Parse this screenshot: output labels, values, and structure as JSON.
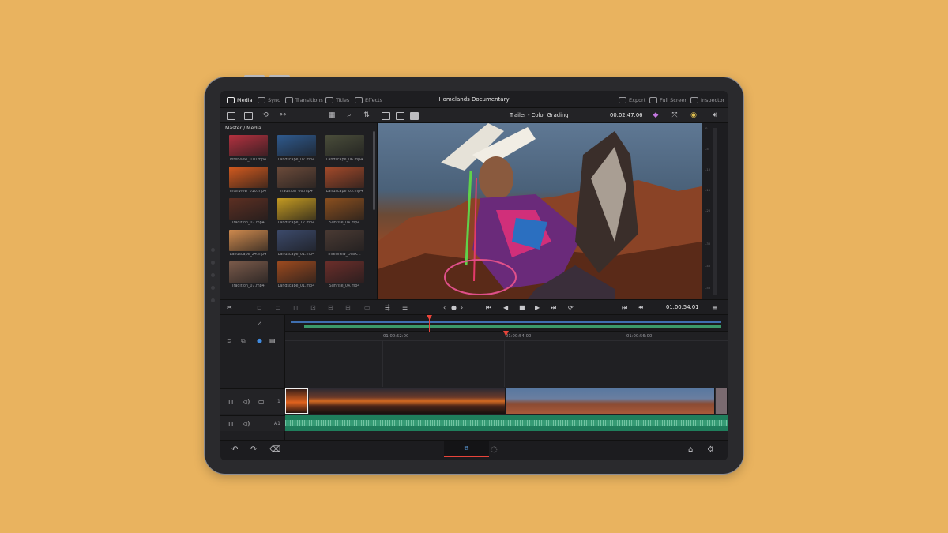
{
  "app": {
    "title": "Homelands Documentary"
  },
  "topbar": {
    "tabs": [
      {
        "label": "Media",
        "icon": "media-icon",
        "active": true
      },
      {
        "label": "Sync",
        "icon": "sync-icon"
      },
      {
        "label": "Transitions",
        "icon": "transitions-icon"
      },
      {
        "label": "Titles",
        "icon": "titles-icon"
      },
      {
        "label": "Effects",
        "icon": "effects-icon"
      }
    ],
    "right": [
      {
        "label": "Export",
        "icon": "export-icon"
      },
      {
        "label": "Full Screen",
        "icon": "full-screen-icon"
      },
      {
        "label": "Inspector",
        "icon": "inspector-icon"
      }
    ]
  },
  "toolbar": {
    "preview_name": "Trailer - Color Grading",
    "timecode": "00:02:47:06"
  },
  "media": {
    "path": "Master / Media",
    "clips": [
      {
        "label": "Interview_010.mp4",
        "color": "#b3313f"
      },
      {
        "label": "Landscape_02.mp4",
        "color": "#2f5a8e"
      },
      {
        "label": "Landscape_06.mp4",
        "color": "#4a4d3a"
      },
      {
        "label": "Interview_010.mp4",
        "color": "#d35a1e"
      },
      {
        "label": "Tradition_06.mp4",
        "color": "#6c4b3a"
      },
      {
        "label": "Landscape_03.mp4",
        "color": "#a44a2a"
      },
      {
        "label": "Tradition_07.mp4",
        "color": "#5c2f22"
      },
      {
        "label": "Landscape_12.mp4",
        "color": "#c49a22"
      },
      {
        "label": "Sunrise_04.mp4",
        "color": "#8a4f1f"
      },
      {
        "label": "Landscape_24.mp4",
        "color": "#cf8a4e"
      },
      {
        "label": "Landscape_01.mp4",
        "color": "#3c4a6b"
      },
      {
        "label": "Interview_Dusk...",
        "color": "#4a3a33"
      },
      {
        "label": "Tradition_07.mp4",
        "color": "#7a5a4a"
      },
      {
        "label": "Landscape_01.mp4",
        "color": "#9c4a1f"
      },
      {
        "label": "Sunrise_04.mp4",
        "color": "#6b2e2a"
      }
    ]
  },
  "transport": {
    "timecode": "01:00:54:01"
  },
  "timeline": {
    "ruler": [
      "01:00:52:00",
      "01:00:54:00",
      "01:00:56:00"
    ],
    "video_track_label": "1",
    "audio_track_label": "A1"
  },
  "colors": {
    "accent": "#e8443a",
    "audio": "#1f7e5c",
    "overview_video": "#3f6fb0",
    "background": "#E9B35F"
  }
}
